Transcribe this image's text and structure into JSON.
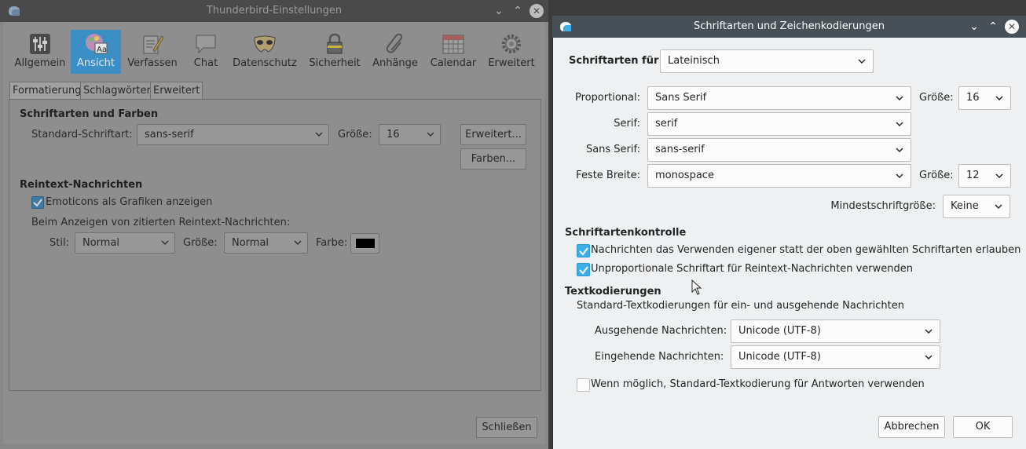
{
  "main_window": {
    "title": "Thunderbird-Einstellungen",
    "toolbar": [
      "Allgemein",
      "Ansicht",
      "Verfassen",
      "Chat",
      "Datenschutz",
      "Sicherheit",
      "Anhänge",
      "Calendar",
      "Erweitert"
    ],
    "tabs": [
      "Formatierung",
      "Schlagwörter",
      "Erweitert"
    ],
    "fonts_section": "Schriftarten und Farben",
    "default_font_label": "Standard-Schriftart:",
    "default_font_value": "sans-serif",
    "size_label": "Größe:",
    "size_value": "16",
    "advanced_button": "Erweitert...",
    "colors_button": "Farben...",
    "plaintext_section": "Reintext-Nachrichten",
    "emoticons_label": "Emoticons als Grafiken anzeigen",
    "quoted_label": "Beim Anzeigen von zitierten Reintext-Nachrichten:",
    "style_label": "Stil:",
    "style_value": "Normal",
    "quoted_size_label": "Größe:",
    "quoted_size_value": "Normal",
    "color_label": "Farbe:",
    "color_swatch": "#000000",
    "close_button": "Schließen"
  },
  "dialog": {
    "title": "Schriftarten und Zeichenkodierungen",
    "fonts_for_label": "Schriftarten für",
    "fonts_for_value": "Lateinisch",
    "proportional_label": "Proportional:",
    "proportional_value": "Sans Serif",
    "prop_size_label": "Größe:",
    "prop_size_value": "16",
    "serif_label": "Serif:",
    "serif_value": "serif",
    "sans_label": "Sans Serif:",
    "sans_value": "sans-serif",
    "mono_label": "Feste Breite:",
    "mono_value": "monospace",
    "mono_size_label": "Größe:",
    "mono_size_value": "12",
    "min_size_label": "Mindestschriftgröße:",
    "min_size_value": "Keine",
    "control_section": "Schriftartenkontrolle",
    "allow_fonts_label": "Nachrichten das Verwenden eigener statt der oben gewählten Schriftarten erlauben",
    "mono_plain_label": "Unproportionale Schriftart für Reintext-Nachrichten verwenden",
    "encoding_section": "Textkodierungen",
    "encoding_desc": "Standard-Textkodierungen für ein- und ausgehende Nachrichten",
    "outgoing_label": "Ausgehende Nachrichten:",
    "outgoing_value": "Unicode (UTF-8)",
    "incoming_label": "Eingehende Nachrichten:",
    "incoming_value": "Unicode (UTF-8)",
    "reply_label": "Wenn möglich, Standard-Textkodierung für Antworten verwenden",
    "cancel_button": "Abbrechen",
    "ok_button": "OK"
  },
  "checks": {
    "emoticons": true,
    "allow_fonts": true,
    "mono_plain": true,
    "reply_default": false
  }
}
